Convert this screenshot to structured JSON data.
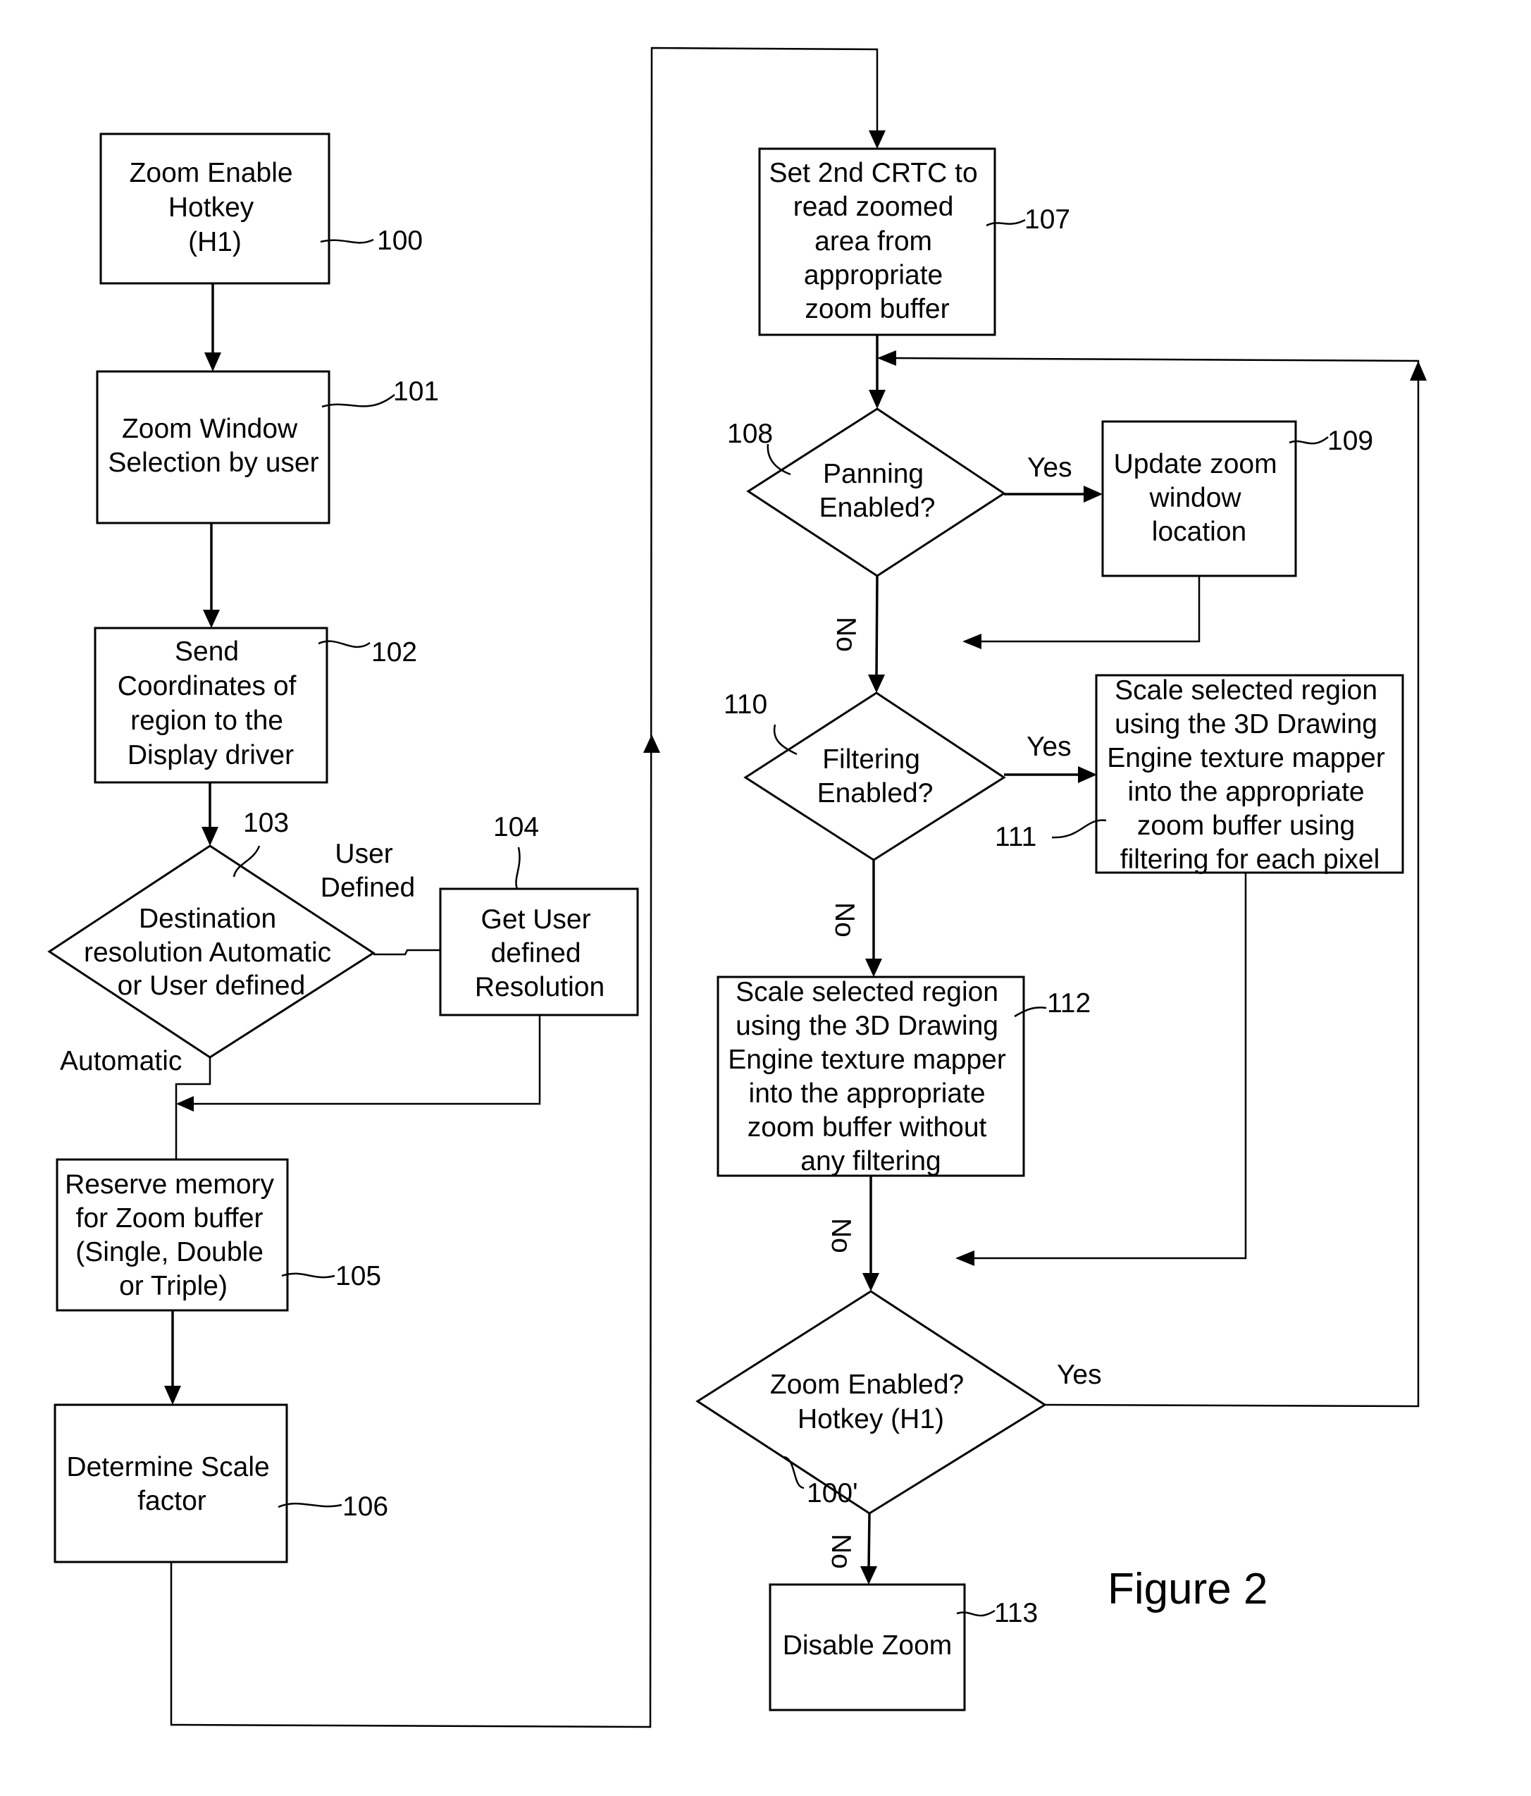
{
  "figure": {
    "title": "Figure 2"
  },
  "nodes": {
    "n100": {
      "ref": "100",
      "lines": [
        "Zoom Enable",
        "Hotkey",
        "(H1)"
      ]
    },
    "n101": {
      "ref": "101",
      "lines": [
        "Zoom Window",
        "Selection by user"
      ]
    },
    "n102": {
      "ref": "102",
      "lines": [
        "Send",
        "Coordinates of",
        "region to the",
        "Display driver"
      ]
    },
    "n103": {
      "ref": "103",
      "lines": [
        "Destination",
        "resolution Automatic",
        "or User defined"
      ]
    },
    "n104": {
      "ref": "104",
      "lines": [
        "Get User",
        "defined",
        "Resolution"
      ]
    },
    "n105": {
      "ref": "105",
      "lines": [
        "Reserve memory",
        "for Zoom buffer",
        "(Single, Double",
        "or Triple)"
      ]
    },
    "n106": {
      "ref": "106",
      "lines": [
        "Determine Scale",
        "factor"
      ]
    },
    "n107": {
      "ref": "107",
      "lines": [
        "Set 2nd CRTC to",
        "read zoomed",
        "area from",
        "appropriate",
        "zoom buffer"
      ]
    },
    "n108": {
      "ref": "108",
      "lines": [
        "Panning",
        "Enabled?"
      ]
    },
    "n109": {
      "ref": "109",
      "lines": [
        "Update zoom",
        "window",
        "location"
      ]
    },
    "n110": {
      "ref": "110",
      "lines": [
        "Filtering",
        "Enabled?"
      ]
    },
    "n111": {
      "ref": "111",
      "lines": [
        "Scale selected region",
        "using the 3D Drawing",
        "Engine texture mapper",
        "into the appropriate",
        "zoom buffer using",
        "filtering for each pixel"
      ]
    },
    "n112": {
      "ref": "112",
      "lines": [
        "Scale selected region",
        "using the 3D Drawing",
        "Engine texture mapper",
        "into the appropriate",
        "zoom buffer without",
        "any filtering"
      ]
    },
    "n100p": {
      "ref": "100'",
      "lines": [
        "Zoom Enabled?",
        "Hotkey (H1)"
      ]
    },
    "n113": {
      "ref": "113",
      "lines": [
        "Disable Zoom"
      ]
    }
  },
  "edge_labels": {
    "user_defined": [
      "User",
      "Defined"
    ],
    "automatic": "Automatic",
    "yes_108": "Yes",
    "no_108": "No",
    "yes_110": "Yes",
    "no_110": "No",
    "no_112": "No",
    "yes_100p": "Yes",
    "no_100p": "No"
  }
}
